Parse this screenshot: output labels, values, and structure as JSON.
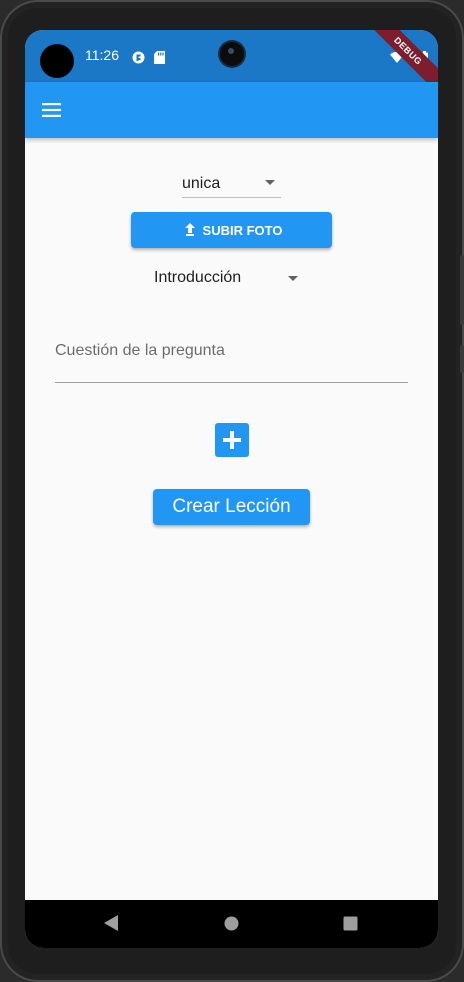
{
  "status_bar": {
    "time": "11:26",
    "icons": [
      "notification-app-icon",
      "sd-card-icon",
      "wifi-icon",
      "signal-icon",
      "battery-icon"
    ],
    "debug_banner": "DEBUG"
  },
  "app_bar": {
    "menu_icon": "hamburger-menu-icon"
  },
  "form": {
    "question_type": {
      "selected": "unica"
    },
    "upload_photo_label": "SUBIR FOTO",
    "section": {
      "selected": "Introducción"
    },
    "question_field": {
      "placeholder": "Cuestión de la pregunta",
      "value": ""
    },
    "add_icon": "add-box-icon",
    "create_lesson_label": "Crear Lección"
  },
  "nav_bar": {
    "icons": [
      "back-triangle-icon",
      "home-circle-icon",
      "recents-square-icon"
    ]
  },
  "colors": {
    "primary": "#2196f3",
    "status_bar": "#1a78c6",
    "background": "#fafafa",
    "debug_banner": "#7c1e2e"
  }
}
